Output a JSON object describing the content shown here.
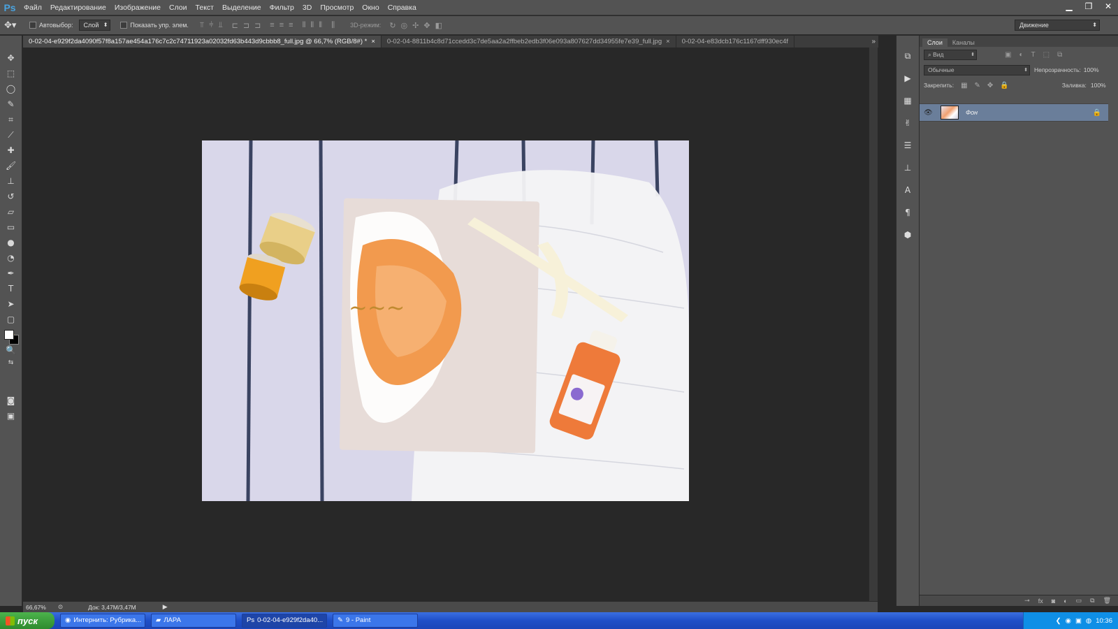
{
  "app": {
    "logo": "Ps"
  },
  "menu": [
    "Файл",
    "Редактирование",
    "Изображение",
    "Слои",
    "Текст",
    "Выделение",
    "Фильтр",
    "3D",
    "Просмотр",
    "Окно",
    "Справка"
  ],
  "options": {
    "autoselect_label": "Автовыбор:",
    "autoselect_value": "Слой",
    "show_controls_label": "Показать упр. элем.",
    "mode_3d_label": "3D-режим:",
    "workspace": "Движение"
  },
  "tabs": [
    {
      "title": "0-02-04-e929f2da4090f57f8a157ae454a176c7c2c74711923a02032fd63b443d9cbbb8_full.jpg @ 66,7% (RGB/8#) *",
      "close": "×"
    },
    {
      "title": "0-02-04-8811b4c8d71ccedd3c7de5aa2a2ffbeb2edb3f06e093a807627dd34955fe7e39_full.jpg",
      "close": "×"
    },
    {
      "title": "0-02-04-e83dcb176c1167dff930ec4f",
      "close": ""
    }
  ],
  "status": {
    "zoom": "66,67%",
    "doc": "Док: 3,47M/3,47M"
  },
  "layers_panel": {
    "tabs": [
      "Слои",
      "Каналы"
    ],
    "filter_kind": "Вид",
    "blend_mode": "Обычные",
    "opacity_label": "Непрозрачность:",
    "opacity_value": "100%",
    "lock_label": "Закрепить:",
    "fill_label": "Заливка:",
    "fill_value": "100%",
    "layer_name": "Фон"
  },
  "taskbar": {
    "start": "пуск",
    "items": [
      "Интернить: Рубрика...",
      "ЛАРА",
      "0-02-04-e929f2da40...",
      "9 - Paint"
    ],
    "clock": "10:36"
  }
}
